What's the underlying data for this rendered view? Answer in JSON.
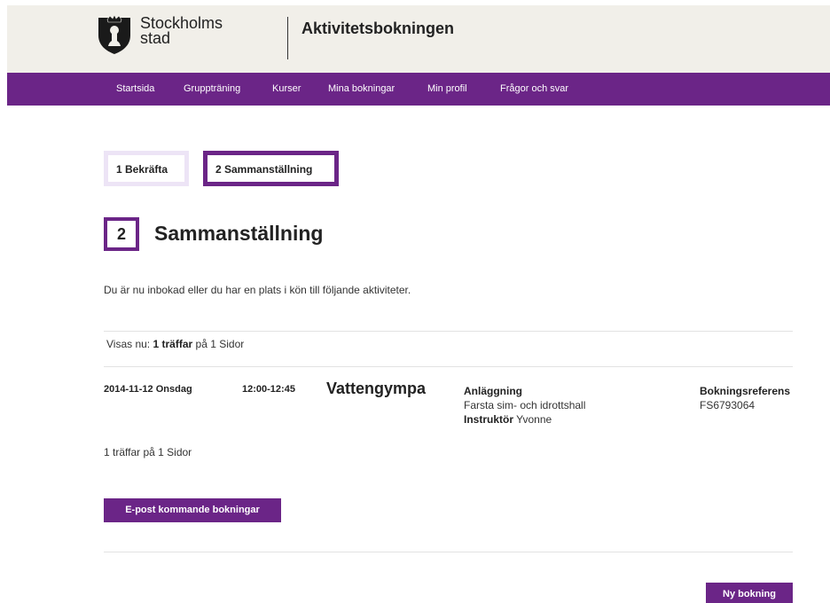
{
  "header": {
    "logo_line1": "Stockholms",
    "logo_line2": "stad",
    "app_title": "Aktivitetsbokningen"
  },
  "nav": {
    "items": [
      "Startsida",
      "Gruppträning",
      "Kurser",
      "Mina bokningar",
      "Min profil",
      "Frågor och svar"
    ]
  },
  "steps": [
    {
      "label": "1 Bekräfta",
      "active": false
    },
    {
      "label": "2 Sammanställning",
      "active": true
    }
  ],
  "section": {
    "number": "2",
    "title": "Sammanställning"
  },
  "intro_text": "Du är nu inbokad eller du har en plats i kön till följande aktiviteter.",
  "results_top": {
    "prefix": "Visas nu:",
    "hits": "1 träffar",
    "suffix": "på 1 Sidor"
  },
  "booking": {
    "date": "2014-11-12 Onsdag",
    "time": "12:00-12:45",
    "name": "Vattengympa",
    "facility_label": "Anläggning",
    "facility": "Farsta sim- och idrottshall",
    "instructor_label": "Instruktör",
    "instructor": "Yvonne",
    "ref_label": "Bokningsreferens",
    "ref": "FS6793064"
  },
  "results_bottom": "1 träffar på 1 Sidor",
  "buttons": {
    "email_upcoming": "E-post kommande bokningar",
    "new_booking": "Ny bokning"
  },
  "colors": {
    "brand_purple": "#6b2587",
    "step_inactive_border": "#ede4f6",
    "header_bg": "#f1efe9"
  }
}
